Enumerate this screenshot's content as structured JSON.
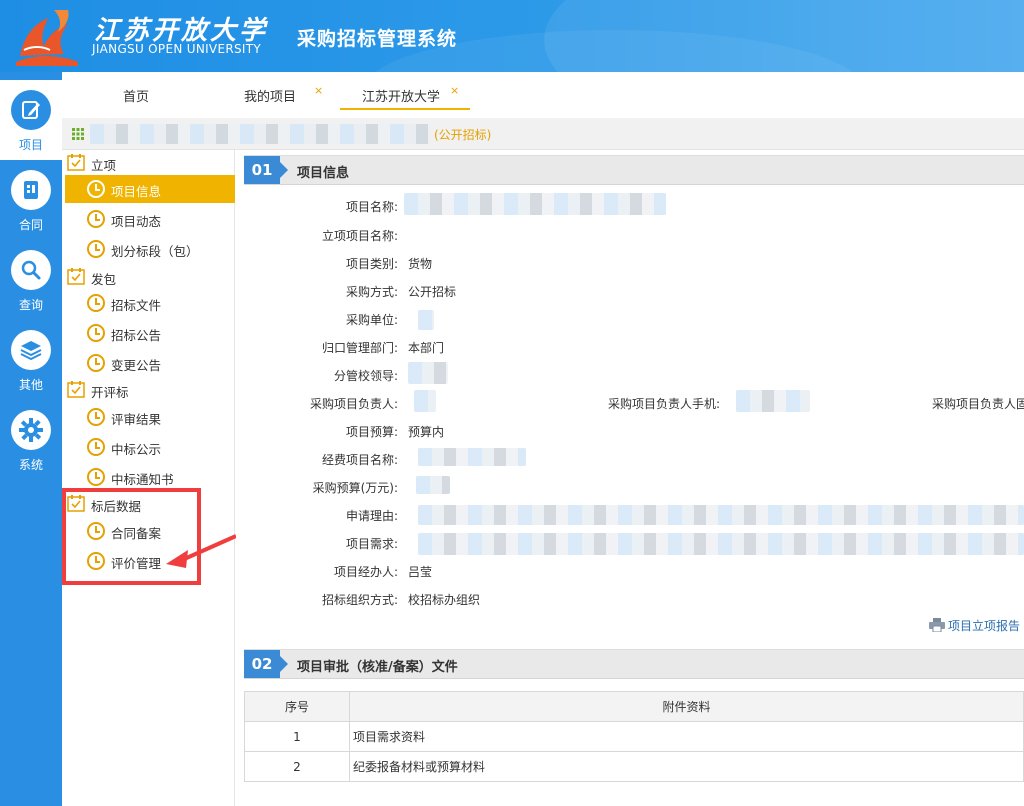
{
  "header": {
    "logo_cn": "江苏开放大学",
    "logo_en": "JIANGSU OPEN UNIVERSITY",
    "system_title": "采购招标管理系统"
  },
  "rail": [
    {
      "label": "项目",
      "icon": "edit-icon",
      "active": true
    },
    {
      "label": "合同",
      "icon": "document-icon"
    },
    {
      "label": "查询",
      "icon": "search-icon"
    },
    {
      "label": "其他",
      "icon": "layers-icon"
    },
    {
      "label": "系统",
      "icon": "gear-icon"
    }
  ],
  "tabs": [
    {
      "label": "首页"
    },
    {
      "label": "我的项目",
      "close": "×"
    },
    {
      "label": "江苏开放大学",
      "close": "×",
      "active": true
    }
  ],
  "crumb": {
    "tag": "(公开招标)"
  },
  "menu": {
    "groups": [
      {
        "label": "立项",
        "items": [
          "项目信息",
          "项目动态",
          "划分标段（包）"
        ]
      },
      {
        "label": "发包",
        "items": [
          "招标文件",
          "招标公告",
          "变更公告"
        ]
      },
      {
        "label": "开评标",
        "items": [
          "评审结果",
          "中标公示",
          "中标通知书"
        ]
      },
      {
        "label": "标后数据",
        "items": [
          "合同备案",
          "评价管理"
        ]
      }
    ],
    "active_item": "项目信息"
  },
  "section1": {
    "num": "01",
    "title": "项目信息",
    "fields": [
      {
        "label": "项目名称:",
        "value": ""
      },
      {
        "label": "立项项目名称:",
        "value": ""
      },
      {
        "label": "项目类别:",
        "value": "货物"
      },
      {
        "label": "采购方式:",
        "value": "公开招标"
      },
      {
        "label": "采购单位:",
        "value": ""
      },
      {
        "label": "归口管理部门:",
        "value": "本部门"
      },
      {
        "label": "分管校领导:",
        "value": ""
      },
      {
        "label": "采购项目负责人:",
        "value": ""
      },
      {
        "label": "项目预算:",
        "value": "预算内"
      },
      {
        "label": "经费项目名称:",
        "value": ""
      },
      {
        "label": "采购预算(万元):",
        "value": ""
      },
      {
        "label": "申请理由:",
        "value": ""
      },
      {
        "label": "项目需求:",
        "value": ""
      },
      {
        "label": "项目经办人:",
        "value": "吕莹"
      },
      {
        "label": "招标组织方式:",
        "value": "校招标办组织"
      }
    ],
    "phone_label": "采购项目负责人手机:",
    "fixed_label": "采购项目负责人固",
    "report_link": "项目立项报告"
  },
  "section2": {
    "num": "02",
    "title": "项目审批（核准/备案）文件",
    "columns": [
      "序号",
      "附件资料"
    ],
    "rows": [
      [
        "1",
        "项目需求资料"
      ],
      [
        "2",
        "纪委报备材料或预算材料"
      ]
    ]
  }
}
